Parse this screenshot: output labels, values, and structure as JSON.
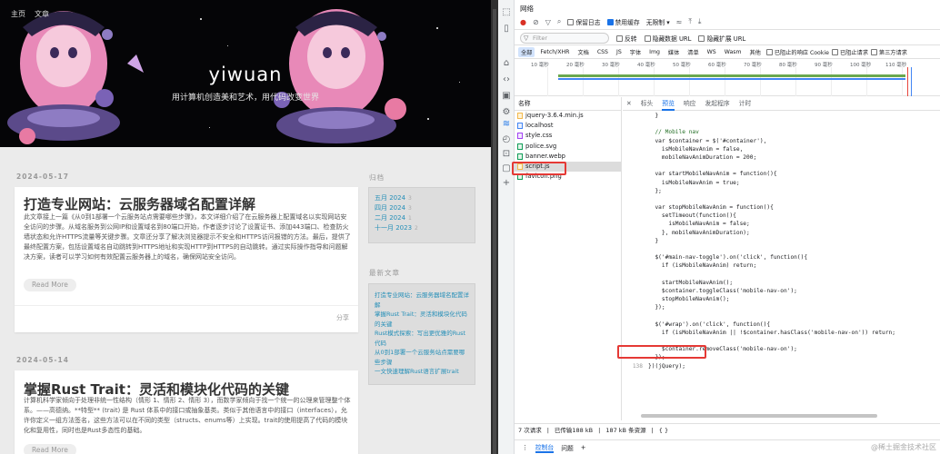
{
  "blog": {
    "nav": [
      "主页",
      "文章"
    ],
    "site_title": "yiwuan",
    "site_subtitle": "用计算机创造美和艺术，用代码改变世界",
    "posts": [
      {
        "date": "2024-05-17",
        "title": "打造专业网站：云服务器域名配置详解",
        "excerpt": "此文章接上一篇《从0到1部署一个云服务站点需要哪些步骤》，本文详细介绍了在云服务器上配置域名以实现网站安全访问的步骤。从域名服务到公网IP和设置域名到80端口开始，作者逐步讨论了设置证书、添加443端口、检查防火墙状态和允许HTTPS流量等关键步骤。文章还分享了解决浏览器提示不安全和HTTPS访问报错的方法。最后，提供了最终配置方案，包括设置域名自动跳转到HTTPS地址和实现HTTP到HTTPS的自动跳转。通过实际操作指导和问题解决方案，读者可以学习如何有效配置云服务器上的域名，确保网站安全访问。",
        "read_more": "Read More",
        "share": "分享"
      },
      {
        "date": "2024-05-14",
        "title": "掌握Rust Trait：灵活和模块化代码的关键",
        "excerpt": "计算机科学家倾向于处理非统一性结构（情形 1、情形 2、情形 3），而数学家倾向于找一个统一的公理来管理整个体系。——高德纳。**特型** (trait) 是 Rust 体系中的接口或抽象基类。类似于其他语言中的接口（interfaces），允许你定义一组方法签名，这些方法可以在不同的类型（structs、enums等）上实现。trait的使用提高了代码的模块化和复用性，同时也是Rust多态性的基础。",
        "read_more": "Read More"
      }
    ],
    "archive_title": "归档",
    "archives": [
      {
        "label": "五月 2024",
        "count": "3"
      },
      {
        "label": "四月 2024",
        "count": "3"
      },
      {
        "label": "二月 2024",
        "count": "1"
      },
      {
        "label": "十一月 2023",
        "count": "2"
      }
    ],
    "recent_title": "最新文章",
    "recent": [
      "打造专业网站：云服务器域名配置详解",
      "掌握Rust Trait：灵活和模块化代码的关键",
      "Rust模式探索：写出更优雅的Rust代码",
      "从0到1部署一个云服务站点需要哪些步骤",
      "一文快速理解Rust语言扩展trait"
    ]
  },
  "devtools": {
    "panel_title": "网络",
    "toolbar": {
      "preserve_log": "保留日志",
      "disable_cache": "禁用缓存",
      "throttle": "无限制"
    },
    "filter": {
      "placeholder": "Filter",
      "invert": "反转",
      "hide_data_urls": "隐藏数据 URL",
      "hide_extension_urls": "隐藏扩展 URL"
    },
    "types": [
      "全部",
      "Fetch/XHR",
      "文档",
      "CSS",
      "JS",
      "字体",
      "Img",
      "媒体",
      "清单",
      "WS",
      "Wasm",
      "其他"
    ],
    "type_opts": {
      "blocked_cookies": "已阻止的响应 Cookie",
      "blocked_requests": "已阻止请求",
      "third_party": "第三方请求"
    },
    "ticks": [
      "10 毫秒",
      "20 毫秒",
      "30 毫秒",
      "40 毫秒",
      "50 毫秒",
      "60 毫秒",
      "70 毫秒",
      "80 毫秒",
      "90 毫秒",
      "100 毫秒",
      "110 毫秒"
    ],
    "name_header": "名称",
    "requests": [
      "jquery-3.6.4.min.js",
      "localhost",
      "style.css",
      "police.svg",
      "banner.webp",
      "script.js",
      "favicon.png"
    ],
    "selected_index": 5,
    "detail_tabs": [
      "标头",
      "预览",
      "响应",
      "发起程序",
      "计时"
    ],
    "active_detail_tab": 1,
    "code_lines": [
      {
        "n": "",
        "t": "  }"
      },
      {
        "n": "",
        "t": ""
      },
      {
        "n": "",
        "t": "  // Mobile nav"
      },
      {
        "n": "",
        "t": "  var $container = $('#container'),"
      },
      {
        "n": "",
        "t": "    isMobileNavAnim = false,"
      },
      {
        "n": "",
        "t": "    mobileNavAnimDuration = 200;"
      },
      {
        "n": "",
        "t": ""
      },
      {
        "n": "",
        "t": "  var startMobileNavAnim = function(){"
      },
      {
        "n": "",
        "t": "    isMobileNavAnim = true;"
      },
      {
        "n": "",
        "t": "  };"
      },
      {
        "n": "",
        "t": ""
      },
      {
        "n": "",
        "t": "  var stopMobileNavAnim = function(){"
      },
      {
        "n": "",
        "t": "    setTimeout(function(){"
      },
      {
        "n": "",
        "t": "      isMobileNavAnim = false;"
      },
      {
        "n": "",
        "t": "    }, mobileNavAnimDuration);"
      },
      {
        "n": "",
        "t": "  }"
      },
      {
        "n": "",
        "t": ""
      },
      {
        "n": "",
        "t": "  $('#main-nav-toggle').on('click', function(){"
      },
      {
        "n": "",
        "t": "    if (isMobileNavAnim) return;"
      },
      {
        "n": "",
        "t": ""
      },
      {
        "n": "",
        "t": "    startMobileNavAnim();"
      },
      {
        "n": "",
        "t": "    $container.toggleClass('mobile-nav-on');"
      },
      {
        "n": "",
        "t": "    stopMobileNavAnim();"
      },
      {
        "n": "",
        "t": "  });"
      },
      {
        "n": "",
        "t": ""
      },
      {
        "n": "",
        "t": "  $('#wrap').on('click', function(){"
      },
      {
        "n": "",
        "t": "    if (isMobileNavAnim || !$container.hasClass('mobile-nav-on')) return;"
      },
      {
        "n": "",
        "t": ""
      },
      {
        "n": "",
        "t": "    $container.removeClass('mobile-nav-on');"
      },
      {
        "n": "",
        "t": "  });"
      },
      {
        "n": "138",
        "t": "})(jQuery);"
      }
    ],
    "status": {
      "requests": "7 次请求",
      "transferred": "已传输188 kB",
      "resources": "187 kB 条资源"
    },
    "status_braces": "{ }",
    "drawer_tabs": [
      "控制台",
      "问题"
    ],
    "drawer_add": "+"
  },
  "watermark": "@稀土掘金技术社区",
  "colors": {
    "link": "#258fb8",
    "accent": "#1a73e8",
    "highlight_box": "#e53935"
  }
}
